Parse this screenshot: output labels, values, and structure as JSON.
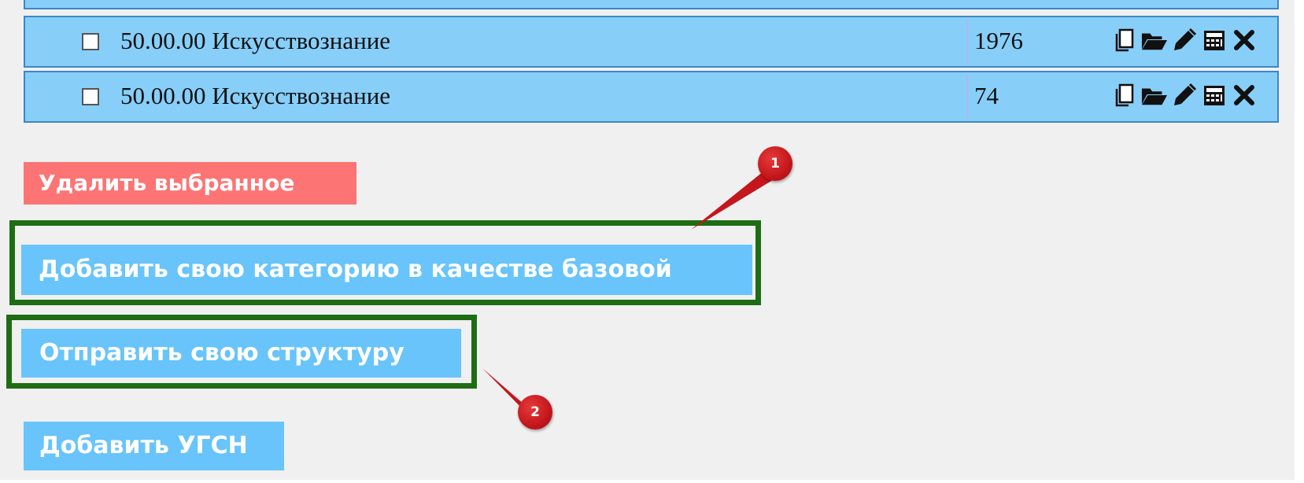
{
  "table": {
    "rows": [
      {
        "name": "50.00.00 Искусствознание",
        "count": "1976",
        "checked": false
      },
      {
        "name": "50.00.00 Искусствознание",
        "count": "74",
        "checked": false
      }
    ],
    "row_actions": [
      {
        "name": "copy-icon"
      },
      {
        "name": "folder-open-icon"
      },
      {
        "name": "pencil-icon"
      },
      {
        "name": "calculator-icon"
      },
      {
        "name": "close-icon"
      }
    ]
  },
  "buttons": {
    "delete_selected": "Удалить выбранное",
    "add_category_as_base": "Добавить свою категорию в качестве базовой",
    "send_structure": "Отправить свою структуру",
    "add_ugsn": "Добавить УГСН"
  },
  "annotations": {
    "marker_1": "1",
    "marker_2": "2"
  },
  "colors": {
    "row_background": "#87cff9",
    "row_border": "#3d86c6",
    "delete_button": "#fd7474",
    "primary_button": "#68c4fb",
    "highlight_frame": "#1e6d14",
    "marker": "#c4161c"
  }
}
